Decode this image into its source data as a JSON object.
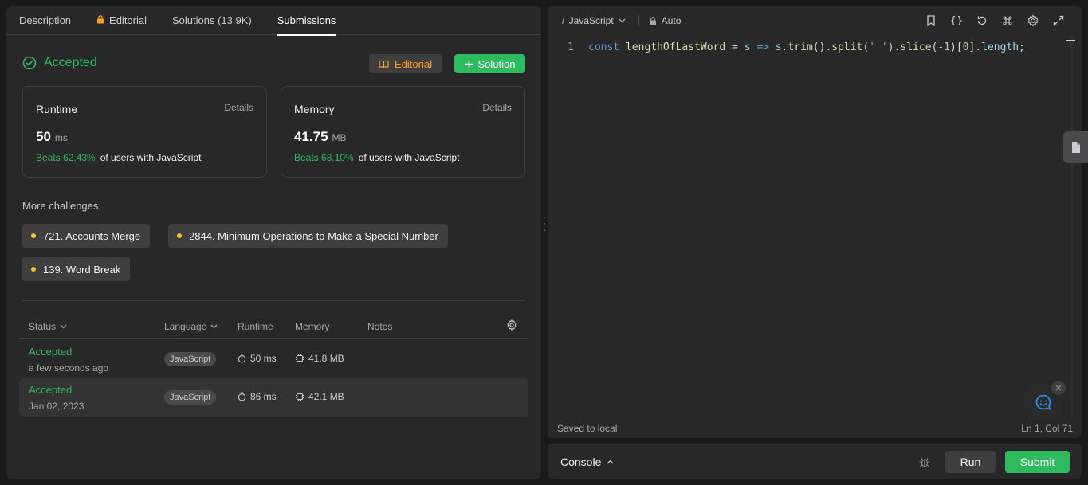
{
  "tabs": [
    {
      "label": "Description"
    },
    {
      "label": "Editorial"
    },
    {
      "label": "Solutions (13.9K)"
    },
    {
      "label": "Submissions"
    }
  ],
  "result": {
    "status": "Accepted",
    "editorial_label": "Editorial",
    "solution_label": "Solution"
  },
  "runtime": {
    "label": "Runtime",
    "details": "Details",
    "value": "50",
    "unit": "ms",
    "beats": "Beats 62.43%",
    "beats_suffix": "of users with JavaScript"
  },
  "memory": {
    "label": "Memory",
    "details": "Details",
    "value": "41.75",
    "unit": "MB",
    "beats": "Beats 68.10%",
    "beats_suffix": "of users with JavaScript"
  },
  "challenges": {
    "title": "More challenges",
    "items": [
      "721. Accounts Merge",
      "2844. Minimum Operations to Make a Special Number",
      "139. Word Break"
    ]
  },
  "table": {
    "headers": {
      "status": "Status",
      "language": "Language",
      "runtime": "Runtime",
      "memory": "Memory",
      "notes": "Notes"
    },
    "rows": [
      {
        "status": "Accepted",
        "time": "a few seconds ago",
        "language": "JavaScript",
        "runtime": "50 ms",
        "memory": "41.8 MB"
      },
      {
        "status": "Accepted",
        "time": "Jan 02, 2023",
        "language": "JavaScript",
        "runtime": "86 ms",
        "memory": "42.1 MB"
      }
    ]
  },
  "editor": {
    "language": "JavaScript",
    "mode": "Auto",
    "line_number": "1",
    "code_tokens": {
      "kw_const": "const",
      "name": "lengthOfLastWord",
      "eq": " = ",
      "param": "s",
      "arrow": " => ",
      "obj": "s",
      "dot1": ".",
      "trim": "trim",
      "p1": "().",
      "split": "split",
      "p2": "(",
      "str": "' '",
      "p3": ").",
      "slice": "slice",
      "p4": "(",
      "neg": "-1",
      "p5": ")[",
      "zero": "0",
      "p6": "].",
      "length": "length",
      "semi": ";"
    },
    "saved": "Saved to local",
    "cursor": "Ln 1, Col 71"
  },
  "console": {
    "label": "Console",
    "run": "Run",
    "submit": "Submit"
  },
  "colors": {
    "accent_green": "#2cbb5d",
    "accent_orange": "#ffa116",
    "dot_yellow": "#ffc01e",
    "panel": "#282828",
    "background": "#1a1a1a"
  }
}
